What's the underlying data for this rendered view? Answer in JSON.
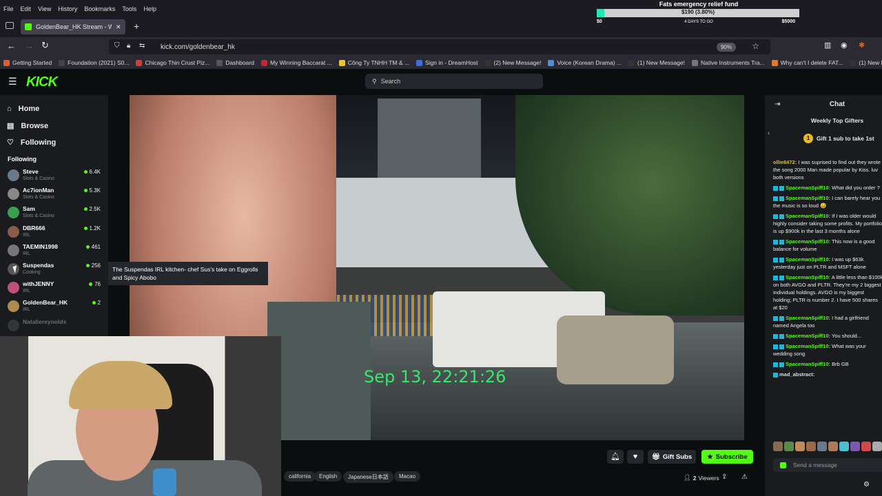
{
  "browser": {
    "menu": [
      "File",
      "Edit",
      "View",
      "History",
      "Bookmarks",
      "Tools",
      "Help"
    ],
    "tab_title": "GoldenBear_HK Stream - W",
    "url": "kick.com/goldenbear_hk",
    "zoom": "90%",
    "bookmarks": [
      {
        "label": "Getting Started",
        "color": "#e25d2b"
      },
      {
        "label": "Foundation (2021) S0...",
        "color": "#444"
      },
      {
        "label": "Chicago Thin Crust Piz...",
        "color": "#d63c2f"
      },
      {
        "label": "Dashboard",
        "color": "#555"
      },
      {
        "label": "My Winning Baccarat ...",
        "color": "#c23"
      },
      {
        "label": "Công Ty TNHH TM & ...",
        "color": "#e8c33a"
      },
      {
        "label": "Sign in - DreamHost",
        "color": "#3b6fe0"
      },
      {
        "label": "(2) New Message!",
        "color": "#333"
      },
      {
        "label": "Voice (Korean Drama) ...",
        "color": "#4a8ee0"
      },
      {
        "label": "(1) New Message!",
        "color": "#333"
      },
      {
        "label": "Native Instruments Tra...",
        "color": "#777"
      },
      {
        "label": "Why can't I delete FAT...",
        "color": "#e2792b"
      },
      {
        "label": "(1) New Message!",
        "color": "#333"
      }
    ]
  },
  "fund": {
    "title": "Fats emergency relief fund",
    "progress_label": "$190 (3.80%)",
    "progress_fraction": 0.038,
    "low": "$0",
    "middle": "4 DAYS TO GO",
    "high": "$5000"
  },
  "header": {
    "logo": "KICK",
    "search_placeholder": "Search"
  },
  "sidebar": {
    "nav": [
      {
        "label": "Home",
        "icon": "home-icon"
      },
      {
        "label": "Browse",
        "icon": "browse-icon"
      },
      {
        "label": "Following",
        "icon": "heart-icon"
      }
    ],
    "following_heading": "Following",
    "channels": [
      {
        "name": "Steve",
        "category": "Slots & Casino",
        "viewers": "6.4K",
        "color": "#6a7a88"
      },
      {
        "name": "Ac7ionMan",
        "category": "Slots & Casino",
        "viewers": "5.3K",
        "color": "#888"
      },
      {
        "name": "Sam",
        "category": "Slots & Casino",
        "viewers": "2.5K",
        "color": "#3aa050"
      },
      {
        "name": "DBR666",
        "category": "IRL",
        "viewers": "1.2K",
        "color": "#8a5a4a"
      },
      {
        "name": "TAEMIN1998",
        "category": "IRL",
        "viewers": "461",
        "color": "#777"
      },
      {
        "name": "Suspendas",
        "category": "Cooking",
        "viewers": "256",
        "color": "#555"
      },
      {
        "name": "withJENNY",
        "category": "IRL",
        "viewers": "76",
        "color": "#c0507a"
      },
      {
        "name": "GoldenBear_HK",
        "category": "IRL",
        "viewers": "2",
        "color": "#b08a50"
      },
      {
        "name": "Natalie​reynolds",
        "category": "",
        "viewers": "",
        "color": "#666"
      }
    ],
    "tooltip": "The Suspendas IRL kitchen- chef Sus's take on Eggrolls and Spicy Abobo"
  },
  "video": {
    "timestamp": "Sep 13, 22:21:26"
  },
  "stream_bar": {
    "tags": [
      "california",
      "English",
      "Japanese日本語",
      "Macao"
    ],
    "gift_label": "Gift Subs",
    "subscribe_label": "Subscribe",
    "viewers_count": "2",
    "viewers_label": "Viewers"
  },
  "chat": {
    "title": "Chat",
    "top_gifters": "Weekly Top Gifters",
    "gift_prompt": "Gift 1 sub to take 1st",
    "gift_rank": "1",
    "messages": [
      {
        "user": "ollie8472:",
        "text": "I was suprised to find out they wrote the song 2000 Man made popular by Kiss. luv both versions",
        "badges": 0
      },
      {
        "user": "SpacemanSpiff10:",
        "text": "What did you order ?",
        "badges": 2
      },
      {
        "user": "SpacemanSpiff10:",
        "text": "I can barely hear you the music is so loud 😅",
        "badges": 2
      },
      {
        "user": "SpacemanSpiff10:",
        "text": "If I was older would highly consider taking some profits. My portfolio is up $900k in the last 3 months alone",
        "badges": 2
      },
      {
        "user": "SpacemanSpiff10:",
        "text": "This now is a good balance for volume",
        "badges": 2
      },
      {
        "user": "SpacemanSpiff10:",
        "text": "I was up $63k yesterday just on PLTR and MSFT alone",
        "badges": 2
      },
      {
        "user": "SpacemanSpiff10:",
        "text": "A little less than $100k on both AVGO and PLTR. They're my 2 biggest individual holdings. AVGO is my biggest holding; PLTR is number 2. I have 500 shares at $20",
        "badges": 2
      },
      {
        "user": "SpacemanSpiff10:",
        "text": "I had a girlfriend named Angela too",
        "badges": 2
      },
      {
        "user": "SpacemanSpiff10:",
        "text": "You should...",
        "badges": 2
      },
      {
        "user": "SpacemanSpiff10:",
        "text": "What was your wedding song",
        "badges": 2
      },
      {
        "user": "SpacemanSpiff10:",
        "text": "Brb GB",
        "badges": 2
      },
      {
        "user": "mad_abstract:",
        "text": "",
        "badges": 1
      }
    ],
    "send_placeholder": "Send a message"
  }
}
